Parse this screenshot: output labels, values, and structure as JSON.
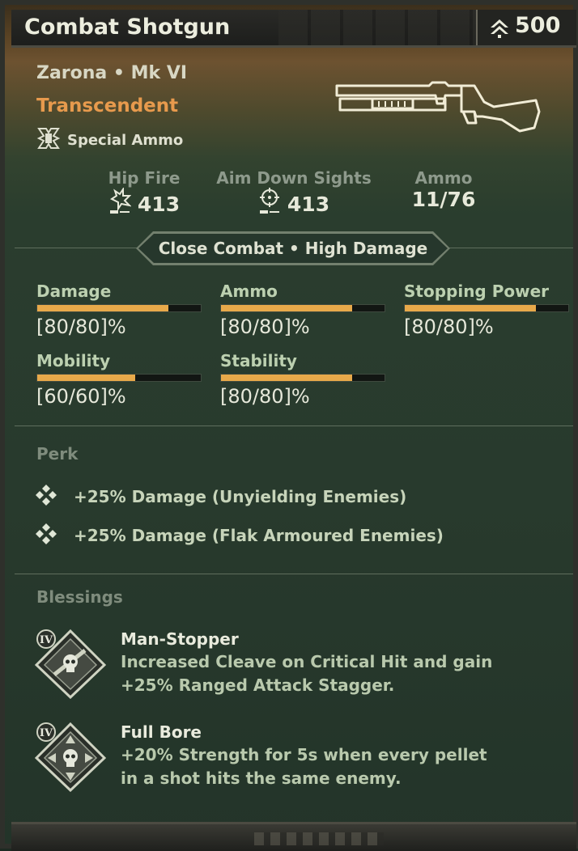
{
  "header": {
    "title": "Combat Shotgun",
    "currency_icon": "rank-chevron-icon",
    "currency_value": "500"
  },
  "item": {
    "subtitle": "Zarona • Mk VI",
    "rarity": "Transcendent",
    "rarity_color": "#e79a4d",
    "special_label": "Special Ammo",
    "special_icon": "special-ammo-icon",
    "weapon_icon": "shotgun-icon"
  },
  "fire_stats": [
    {
      "label": "Hip Fire",
      "value": "413",
      "icon": "hip-fire-icon"
    },
    {
      "label": "Aim Down Sights",
      "value": "413",
      "icon": "crosshair-icon"
    },
    {
      "label": "Ammo",
      "value": "11/76"
    }
  ],
  "ribbon": "Close Combat • High Damage",
  "accent_color": "#e8a94a",
  "stats": [
    {
      "label": "Damage",
      "value": "[80/80]%",
      "fill": 0.8
    },
    {
      "label": "Ammo",
      "value": "[80/80]%",
      "fill": 0.8
    },
    {
      "label": "Stopping Power",
      "value": "[80/80]%",
      "fill": 0.8
    },
    {
      "label": "Mobility",
      "value": "[60/60]%",
      "fill": 0.6
    },
    {
      "label": "Stability",
      "value": "[80/80]%",
      "fill": 0.8
    }
  ],
  "perk": {
    "title": "Perk",
    "items": [
      {
        "text": "+25% Damage (Unyielding Enemies)",
        "icon": "perk-diamond-icon"
      },
      {
        "text": "+25% Damage (Flak Armoured Enemies)",
        "icon": "perk-diamond-icon"
      }
    ]
  },
  "blessings": {
    "title": "Blessings",
    "items": [
      {
        "tier": "IV",
        "name": "Man-Stopper",
        "description": "Increased Cleave on Critical Hit and gain +25% Ranged Attack Stagger.",
        "icon": "skull-blessing-icon"
      },
      {
        "tier": "IV",
        "name": "Full Bore",
        "description": "+20% Strength for 5s when every pellet in a shot hits the same enemy.",
        "icon": "skull-arrows-blessing-icon"
      }
    ]
  }
}
